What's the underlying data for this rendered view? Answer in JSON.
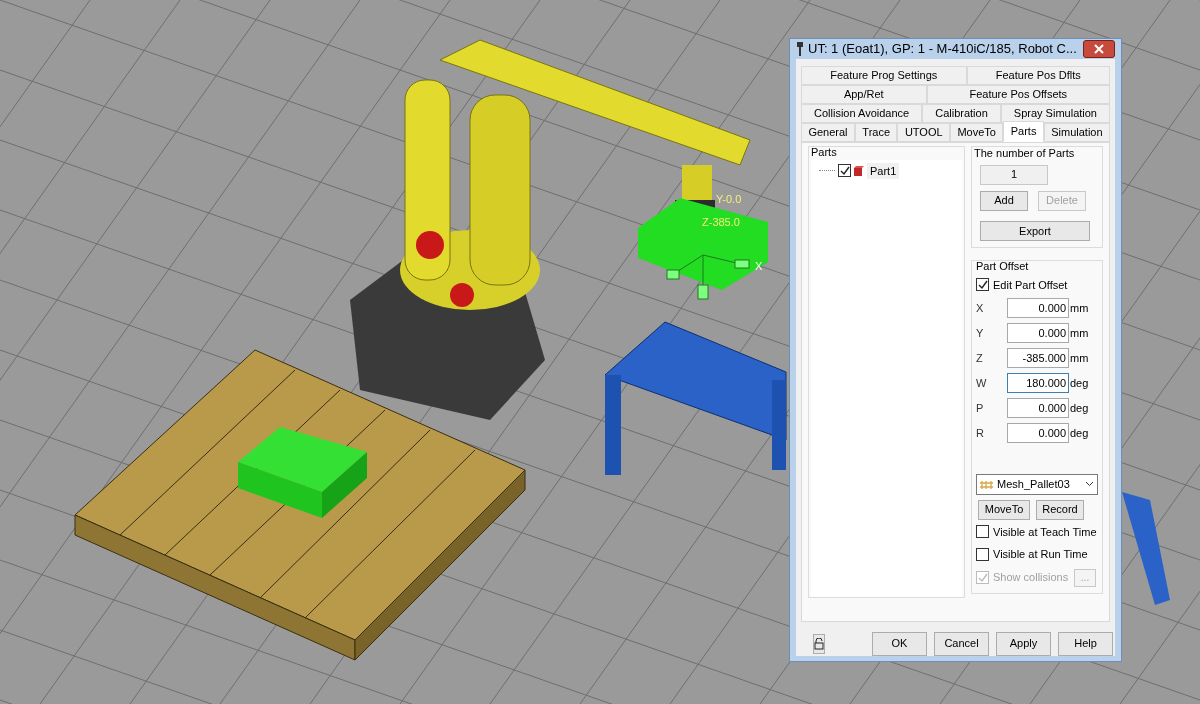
{
  "scene": {
    "labels": [
      {
        "text": "Y-0.0"
      },
      {
        "text": "Z-385.0"
      },
      {
        "text": "X"
      }
    ]
  },
  "dialog": {
    "title": "UT: 1  (Eoat1), GP: 1 - M-410iC/185, Robot C...",
    "tab_rows": [
      [
        {
          "label": "Feature Prog Settings",
          "selected": false
        },
        {
          "label": "Feature Pos Dflts",
          "selected": false
        }
      ],
      [
        {
          "label": "App/Ret",
          "selected": false
        },
        {
          "label": "Feature Pos Offsets",
          "selected": false
        }
      ],
      [
        {
          "label": "Collision Avoidance",
          "selected": false
        },
        {
          "label": "Calibration",
          "selected": false
        },
        {
          "label": "Spray Simulation",
          "selected": false
        }
      ],
      [
        {
          "label": "General",
          "selected": false
        },
        {
          "label": "Trace",
          "selected": false
        },
        {
          "label": "UTOOL",
          "selected": false
        },
        {
          "label": "MoveTo",
          "selected": false
        },
        {
          "label": "Parts",
          "selected": true
        },
        {
          "label": "Simulation",
          "selected": false
        }
      ]
    ],
    "parts_tree": {
      "label": "Parts",
      "items": [
        {
          "label": "Part1",
          "checked": true
        }
      ]
    },
    "number_of_parts": {
      "label": "The number of Parts",
      "value": "1",
      "buttons": [
        {
          "label": "Add",
          "disabled": false
        },
        {
          "label": "Delete",
          "disabled": true
        }
      ],
      "export": "Export"
    },
    "part_offset": {
      "label": "Part Offset",
      "edit": {
        "label": "Edit Part Offset",
        "checked": true
      },
      "fields": [
        {
          "axis": "X",
          "value": "0.000",
          "unit": "mm",
          "focused": false
        },
        {
          "axis": "Y",
          "value": "0.000",
          "unit": "mm",
          "focused": false
        },
        {
          "axis": "Z",
          "value": "-385.000",
          "unit": "mm",
          "focused": false
        },
        {
          "axis": "W",
          "value": "180.000",
          "unit": "deg",
          "focused": true
        },
        {
          "axis": "P",
          "value": "0.000",
          "unit": "deg",
          "focused": false
        },
        {
          "axis": "R",
          "value": "0.000",
          "unit": "deg",
          "focused": false
        }
      ],
      "frame_select": {
        "value": "Mesh_Pallet03"
      },
      "buttons": [
        "MoveTo",
        "Record"
      ],
      "options": [
        {
          "label": "Visible at Teach Time",
          "checked": false,
          "disabled": false
        },
        {
          "label": "Visible at Run Time",
          "checked": false,
          "disabled": false
        },
        {
          "label": "Show collisions",
          "checked": true,
          "disabled": true
        }
      ],
      "ellipsis": "..."
    },
    "footer_buttons": [
      "OK",
      "Cancel",
      "Apply",
      "Help"
    ]
  }
}
